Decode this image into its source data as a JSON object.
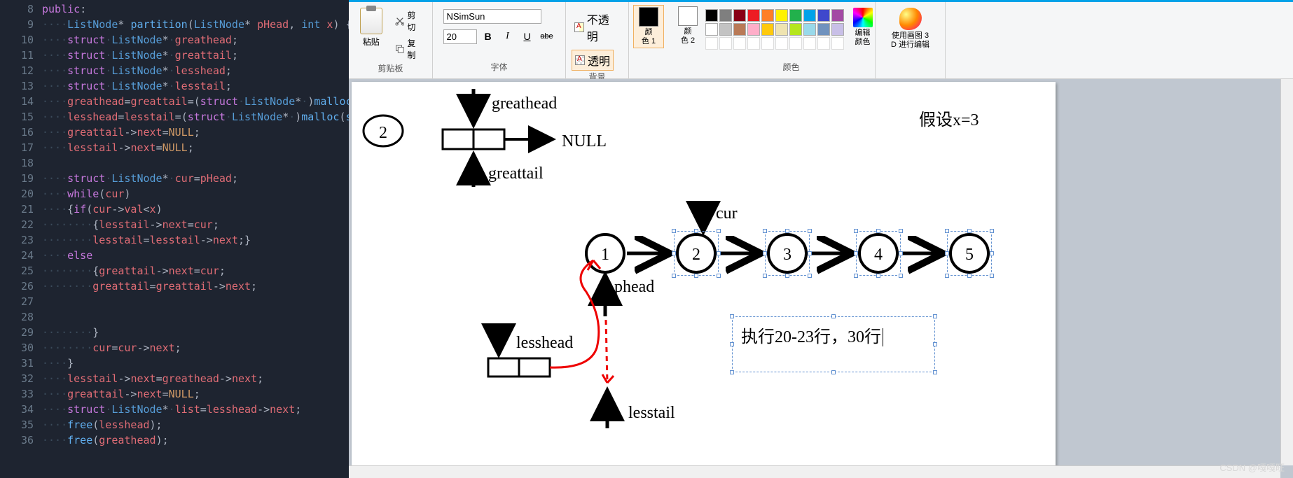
{
  "editor": {
    "lines": [
      {
        "n": 8,
        "html": "<span class='kw'>public</span><span class='punct'>:</span>"
      },
      {
        "n": 9,
        "html": "<span class='dots'>····</span><span class='type'>ListNode</span><span class='op'>*</span> <span class='fn'>partition</span><span class='punct'>(</span><span class='type'>ListNode</span><span class='op'>*</span> <span class='id'>pHead</span><span class='punct'>,</span> <span class='type'>int</span> <span class='id'>x</span><span class='punct'>)</span> <span class='punct'>{</span>"
      },
      {
        "n": 10,
        "html": "<span class='dots'>····</span><span class='kw'>struct</span><span class='dots'>·</span><span class='type'>ListNode</span><span class='op'>*</span><span class='dots'>·</span><span class='id'>greathead</span><span class='punct'>;</span>"
      },
      {
        "n": 11,
        "html": "<span class='dots'>····</span><span class='kw'>struct</span><span class='dots'>·</span><span class='type'>ListNode</span><span class='op'>*</span><span class='dots'>·</span><span class='id'>greattail</span><span class='punct'>;</span>"
      },
      {
        "n": 12,
        "html": "<span class='dots'>····</span><span class='kw'>struct</span><span class='dots'>·</span><span class='type'>ListNode</span><span class='op'>*</span><span class='dots'>·</span><span class='id'>lesshead</span><span class='punct'>;</span>"
      },
      {
        "n": 13,
        "html": "<span class='dots'>····</span><span class='kw'>struct</span><span class='dots'>·</span><span class='type'>ListNode</span><span class='op'>*</span><span class='dots'>·</span><span class='id'>lesstail</span><span class='punct'>;</span>"
      },
      {
        "n": 14,
        "html": "<span class='dots'>····</span><span class='id'>greathead</span><span class='op'>=</span><span class='id'>greattail</span><span class='op'>=</span><span class='punct'>(</span><span class='kw'>struct</span><span class='dots'>·</span><span class='type'>ListNode</span><span class='op'>*</span><span class='dots'>·</span><span class='punct'>)</span><span class='fn'>malloc</span><span class='punct'>(</span><span class='fn'>sizeof</span><span class='punct'>(</span>"
      },
      {
        "n": 15,
        "html": "<span class='dots'>····</span><span class='id'>lesshead</span><span class='op'>=</span><span class='id'>lesstail</span><span class='op'>=</span><span class='punct'>(</span><span class='kw'>struct</span><span class='dots'>·</span><span class='type'>ListNode</span><span class='op'>*</span><span class='dots'>·</span><span class='punct'>)</span><span class='fn'>malloc</span><span class='punct'>(</span><span class='fn'>sizeof</span><span class='punct'>(</span><span class='kw'>s</span>"
      },
      {
        "n": 16,
        "html": "<span class='dots'>····</span><span class='id'>greattail</span><span class='op'>-&gt;</span><span class='id'>next</span><span class='op'>=</span><span class='null'>NULL</span><span class='punct'>;</span>"
      },
      {
        "n": 17,
        "html": "<span class='dots'>····</span><span class='id'>lesstail</span><span class='op'>-&gt;</span><span class='id'>next</span><span class='op'>=</span><span class='null'>NULL</span><span class='punct'>;</span>"
      },
      {
        "n": 18,
        "html": ""
      },
      {
        "n": 19,
        "html": "<span class='dots'>····</span><span class='kw'>struct</span><span class='dots'>·</span><span class='type'>ListNode</span><span class='op'>*</span><span class='dots'>·</span><span class='id'>cur</span><span class='op'>=</span><span class='id'>pHead</span><span class='punct'>;</span>"
      },
      {
        "n": 20,
        "html": "<span class='dots'>····</span><span class='kw'>while</span><span class='punct'>(</span><span class='id'>cur</span><span class='punct'>)</span>"
      },
      {
        "n": 21,
        "html": "<span class='dots'>····</span><span class='punct'>{</span><span class='kw'>if</span><span class='punct'>(</span><span class='id'>cur</span><span class='op'>-&gt;</span><span class='id'>val</span><span class='op'>&lt;</span><span class='id'>x</span><span class='punct'>)</span>"
      },
      {
        "n": 22,
        "html": "<span class='dots'>········</span><span class='punct'>{</span><span class='id'>lesstail</span><span class='op'>-&gt;</span><span class='id'>next</span><span class='op'>=</span><span class='id'>cur</span><span class='punct'>;</span>"
      },
      {
        "n": 23,
        "html": "<span class='dots'>········</span><span class='id'>lesstail</span><span class='op'>=</span><span class='id'>lesstail</span><span class='op'>-&gt;</span><span class='id'>next</span><span class='punct'>;}</span>"
      },
      {
        "n": 24,
        "html": "<span class='dots'>····</span><span class='kw'>else</span>"
      },
      {
        "n": 25,
        "html": "<span class='dots'>········</span><span class='punct'>{</span><span class='id'>greattail</span><span class='op'>-&gt;</span><span class='id'>next</span><span class='op'>=</span><span class='id'>cur</span><span class='punct'>;</span>"
      },
      {
        "n": 26,
        "html": "<span class='dots'>········</span><span class='id'>greattail</span><span class='op'>=</span><span class='id'>greattail</span><span class='op'>-&gt;</span><span class='id'>next</span><span class='punct'>;</span>"
      },
      {
        "n": 27,
        "html": ""
      },
      {
        "n": 28,
        "html": ""
      },
      {
        "n": 29,
        "html": "<span class='dots'>········</span><span class='punct'>}</span>"
      },
      {
        "n": 30,
        "html": "<span class='dots'>········</span><span class='id'>cur</span><span class='op'>=</span><span class='id'>cur</span><span class='op'>-&gt;</span><span class='id'>next</span><span class='punct'>;</span>"
      },
      {
        "n": 31,
        "html": "<span class='dots'>····</span><span class='punct'>}</span>"
      },
      {
        "n": 32,
        "html": "<span class='dots'>····</span><span class='id'>lesstail</span><span class='op'>-&gt;</span><span class='id'>next</span><span class='op'>=</span><span class='id'>greathead</span><span class='op'>-&gt;</span><span class='id'>next</span><span class='punct'>;</span>"
      },
      {
        "n": 33,
        "html": "<span class='dots'>····</span><span class='id'>greattail</span><span class='op'>-&gt;</span><span class='id'>next</span><span class='op'>=</span><span class='null'>NULL</span><span class='punct'>;</span>"
      },
      {
        "n": 34,
        "html": "<span class='dots'>····</span><span class='kw'>struct</span><span class='dots'>·</span><span class='type'>ListNode</span><span class='op'>*</span><span class='dots'>·</span><span class='id'>list</span><span class='op'>=</span><span class='id'>lesshead</span><span class='op'>-&gt;</span><span class='id'>next</span><span class='punct'>;</span>"
      },
      {
        "n": 35,
        "html": "<span class='dots'>····</span><span class='fn'>free</span><span class='punct'>(</span><span class='id'>lesshead</span><span class='punct'>);</span>"
      },
      {
        "n": 36,
        "html": "<span class='dots'>····</span><span class='fn'>free</span><span class='punct'>(</span><span class='id'>greathead</span><span class='punct'>);</span>"
      }
    ]
  },
  "ribbon": {
    "clipboard": {
      "paste": "粘贴",
      "cut": "剪切",
      "copy": "复制",
      "label": "剪贴板"
    },
    "font": {
      "name": "NSimSun",
      "size": "20",
      "label": "字体"
    },
    "bg": {
      "opaque": "不透明",
      "transparent": "透明",
      "label": "背景"
    },
    "color1": {
      "label": "颜\n色 1",
      "hex": "#000000"
    },
    "color2": {
      "label": "颜\n色 2",
      "hex": "#ffffff"
    },
    "palette_label": "颜色",
    "edit_colors": "编辑\n颜色",
    "p3d": "使用画图 3\nD 进行编辑",
    "palette": {
      "row1": [
        "#000000",
        "#7f7f7f",
        "#880015",
        "#ed1c24",
        "#ff7f27",
        "#fff200",
        "#22b14c",
        "#00a2e8",
        "#3f48cc",
        "#a349a4"
      ],
      "row2": [
        "#ffffff",
        "#c3c3c3",
        "#b97a57",
        "#ffaec9",
        "#ffc90e",
        "#efe4b0",
        "#b5e61d",
        "#99d9ea",
        "#7092be",
        "#c8bfe7"
      ]
    }
  },
  "canvas": {
    "step": "2",
    "greathead": "greathead",
    "greattail": "greattail",
    "null": "NULL",
    "assume": "假设x=3",
    "cur": "cur",
    "phead": "phead",
    "lesshead": "lesshead",
    "lesstail": "lesstail",
    "nodes": [
      "1",
      "2",
      "3",
      "4",
      "5"
    ],
    "exec_text": "执行20-23行，30行"
  },
  "watermark": "CSDN @嘎嘎旺"
}
